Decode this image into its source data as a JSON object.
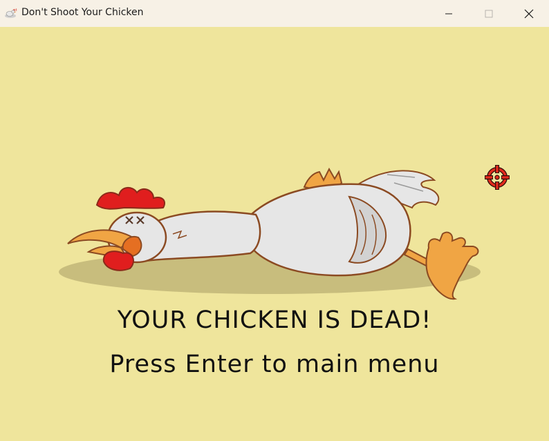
{
  "window": {
    "title": "Don't Shoot Your Chicken",
    "app_icon": "chicken-app-icon",
    "controls": [
      "minimize-icon",
      "maximize-icon",
      "close-icon"
    ]
  },
  "game": {
    "background_color": "#efe59c",
    "illustration": "dead-chicken",
    "cursor": "crosshair-icon",
    "cursor_color": "#e12a1c",
    "message": "YOUR CHICKEN IS DEAD!",
    "prompt": "Press Enter to main menu"
  }
}
